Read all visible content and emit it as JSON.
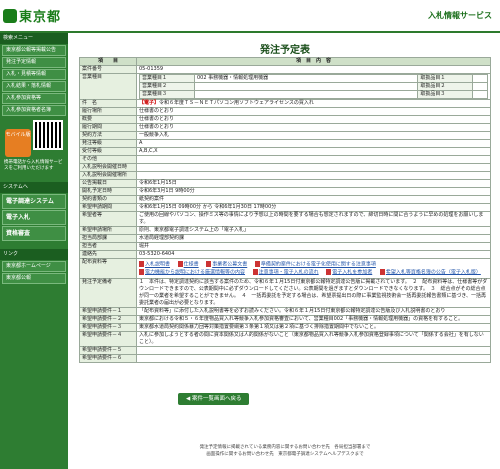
{
  "header": {
    "logo_text": "東京都",
    "system_name": "入札情報サービス"
  },
  "sidebar": {
    "section1": "検索メニュー",
    "items": [
      "東京都公報等掲載公告",
      "発注予定情報",
      "入札・見積等情報",
      "入札結果・落札情報",
      "入札参加資格等",
      "入札参加資格者名簿"
    ],
    "mobile_label": "モバイル版",
    "mobile_note": "携帯電話から入札情報サービスをご利用いただけます",
    "section2": "システムへ",
    "sys_items": [
      "電子調達システム",
      "電子入札",
      "資格審査"
    ],
    "section3": "リンク",
    "links": [
      "東京都ホームページ",
      "東京都公報"
    ]
  },
  "main": {
    "title": "発注予定表",
    "col_item": "項　　目",
    "col_content": "項　目　内　容",
    "fields": [
      {
        "label": "案件番号",
        "value": "05-01359"
      },
      {
        "label": "件　名",
        "value": "令和６年度ＴＳ－ＮＥＴパソコン用ソフトウェアライセンスの買入れ"
      },
      {
        "label": "履行場所",
        "value": "仕様書のとおり"
      },
      {
        "label": "概要",
        "value": "仕様書のとおり"
      },
      {
        "label": "履行期間",
        "value": "仕様書のとおり"
      },
      {
        "label": "契約方法",
        "value": "一般競争入札"
      },
      {
        "label": "発注等級",
        "value": "A"
      },
      {
        "label": "受付等級",
        "value": "A,B,C,X"
      },
      {
        "label": "その他",
        "value": ""
      },
      {
        "label": "入札説明会開催日時",
        "value": ""
      },
      {
        "label": "入札説明会開催場所",
        "value": ""
      },
      {
        "label": "公告掲載日",
        "value": "令和6年1月15日"
      },
      {
        "label": "開札予定日時",
        "value": "令和6年3月1日 9時00分"
      },
      {
        "label": "契約書類の",
        "value": "紙契約案件"
      },
      {
        "label": "希望申請期間",
        "value": "令和6年1月15日 09時00分 から 令和6年1月30日 17時00分"
      },
      {
        "label": "希望者等",
        "value": "ご使用の回線やパソコン、操作ミス等の事情により予想以上の時間を要する場合も想定されますので、締切日時に間に合うように早めの処理をお願いします。"
      },
      {
        "label": "希望申請場所",
        "value": "原則、東京都電子調達システム上の「電子入札」"
      },
      {
        "label": "担当局部課",
        "value": "水道局経理部契約課"
      },
      {
        "label": "担当者",
        "value": "堀井"
      },
      {
        "label": "連絡先",
        "value": "03-5320-6404"
      }
    ],
    "business": {
      "label": "営業種目",
      "r1": "営業種目１",
      "r1v": "002 事務機器・情報処理用機器",
      "r2": "営業種目２",
      "r3": "営業種目３",
      "c1": "取扱品目１",
      "c2": "取扱品目２",
      "c3": "取扱品目３"
    },
    "warn_label": "【電子】",
    "files_label": "配布資料等",
    "files": [
      "入札説明書",
      "仕様書",
      "事業者公募文書",
      "準備契約案件における電子化使用に関する注意事項",
      "電力機能から説明における厳選情報等の内容",
      "注意事項・電子入札の流れ",
      "電子入札を参加者",
      "希望入札等資格名簿の公告（電子入札版）"
    ],
    "notes_label": "発注予定備考",
    "notes": "１　本件は、特定調達契約に該当する案件のため、令和６年１月15日付東京都公報特定調達公告版に掲載されています。　２　配布資料等は、仕様書等がダウンロードできますので、公表期間中に必ずダウンロードしてください。公表期間を過ぎますとダウンロードできなくなります。　３　総合点がその総合点が同一の業者を希望することができません。　４　一括再委託を予定する場合は、希望票提出日の際に事業監視技術会一括再委託報告書類に基づき、一括再委託業者の届出が必要となります。",
    "req1_label": "希望申請要件－１",
    "req1": "「配布資料等」に添付した入札説明書等を必ずお読みください。令和６年１月15日付東京都公報特定調達公告版及び入札説明書のとおり",
    "req2_label": "希望申請要件－２",
    "req2": "東京都における令和５・６年度物品買入れ等競争入札参加資格審査において、営業種目002「事務機器・情報処理用機器」の資格を有すること。",
    "req3_label": "希望申請要件－３",
    "req3": "東京都水道局契約関係暴力団等対策措置要綱第３条第１項又は第２項に基づく排除措置期間中でないこと。",
    "req4_label": "希望申請要件－４",
    "req4": "入札に参加しようとする者の間に資本関係又は人的関係がないこと（東京都物品買入れ等競争入札参加資格登録事項について「関係する会社」を有しないこと）。",
    "req5_label": "希望申請要件－５",
    "req5": "",
    "req6_label": "希望申請要件－６",
    "req6": "",
    "back_button": "◀ 案件一覧画面へ戻る"
  },
  "footer": {
    "line1": "発注予定情報に掲載されている業務内容に関するお問い合わせ先　各局担当部署まで",
    "line2": "画面操作に関するお問い合わせ先　東京都電子調達システムヘルプデスクまで"
  }
}
